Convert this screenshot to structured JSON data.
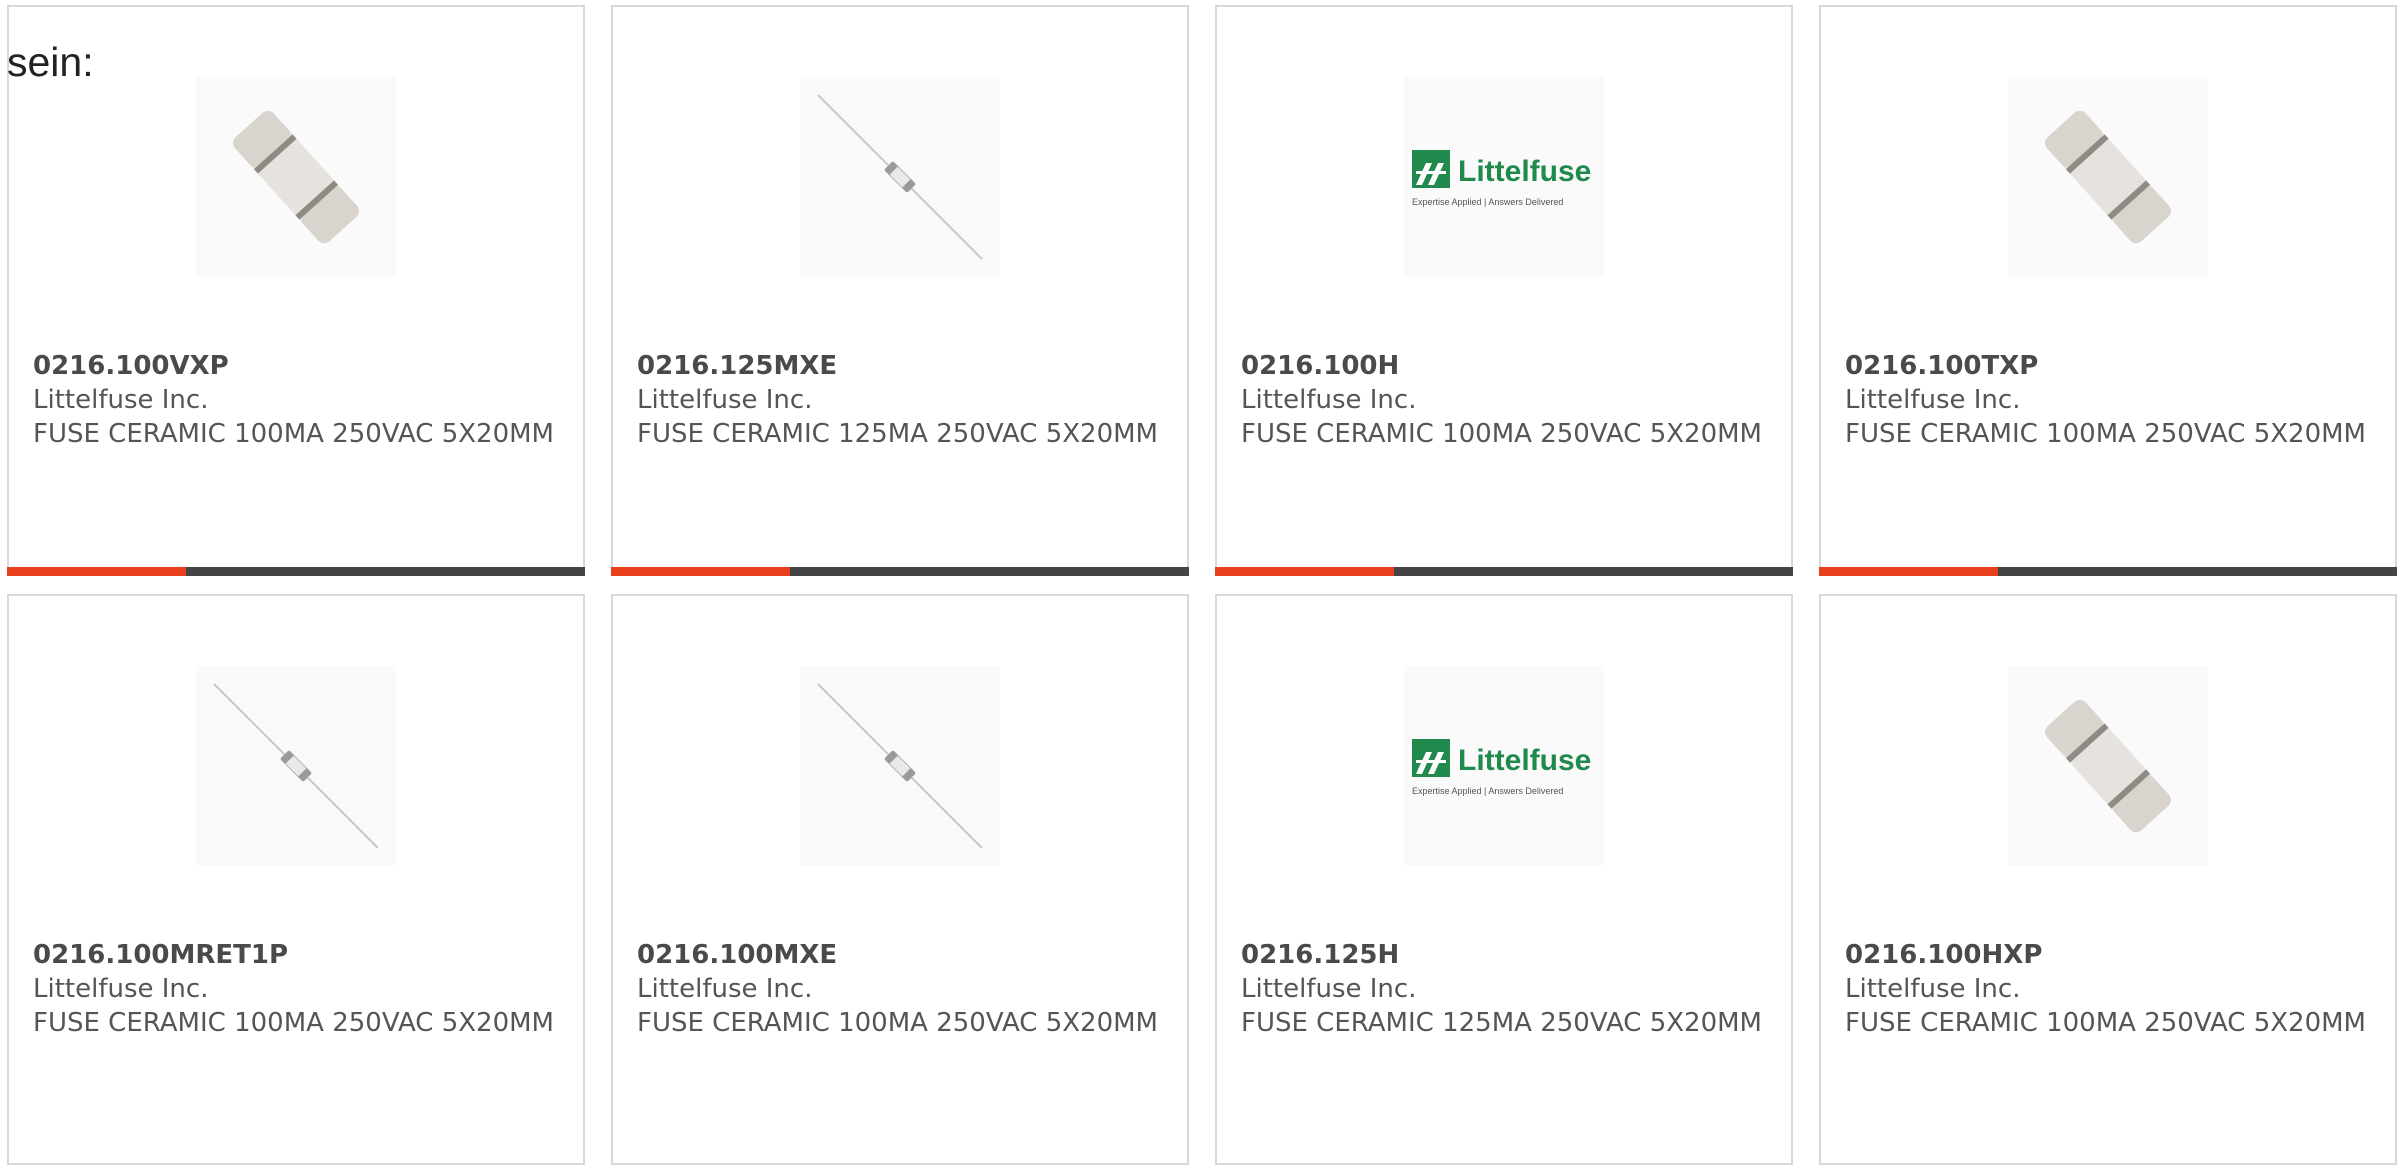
{
  "lead_text": "sein:",
  "colors": {
    "accent": "#e8401c",
    "bar_track": "#444444",
    "card_border": "#d9d9d9",
    "logo_green": "#1f8a4c"
  },
  "logo": {
    "brand": "Littelfuse",
    "tagline": "Expertise Applied | Answers Delivered"
  },
  "cards": [
    {
      "part": "0216.100VXP",
      "manufacturer": "Littelfuse Inc.",
      "description": "FUSE CERAMIC 100MA 250VAC 5X20MM",
      "image": "ceramic-fuse-icon",
      "progress": 0.31
    },
    {
      "part": "0216.125MXE",
      "manufacturer": "Littelfuse Inc.",
      "description": "FUSE CERAMIC 125MA 250VAC 5X20MM",
      "image": "axial-fuse-icon",
      "progress": 0.31
    },
    {
      "part": "0216.100H",
      "manufacturer": "Littelfuse Inc.",
      "description": "FUSE CERAMIC 100MA 250VAC 5X20MM",
      "image": "littelfuse-logo",
      "progress": 0.31
    },
    {
      "part": "0216.100TXP",
      "manufacturer": "Littelfuse Inc.",
      "description": "FUSE CERAMIC 100MA 250VAC 5X20MM",
      "image": "ceramic-fuse-icon",
      "progress": 0.31
    },
    {
      "part": "0216.100MRET1P",
      "manufacturer": "Littelfuse Inc.",
      "description": "FUSE CERAMIC 100MA 250VAC 5X20MM",
      "image": "axial-fuse-icon"
    },
    {
      "part": "0216.100MXE",
      "manufacturer": "Littelfuse Inc.",
      "description": "FUSE CERAMIC 100MA 250VAC 5X20MM",
      "image": "axial-fuse-icon"
    },
    {
      "part": "0216.125H",
      "manufacturer": "Littelfuse Inc.",
      "description": "FUSE CERAMIC 125MA 250VAC 5X20MM",
      "image": "littelfuse-logo"
    },
    {
      "part": "0216.100HXP",
      "manufacturer": "Littelfuse Inc.",
      "description": "FUSE CERAMIC 100MA 250VAC 5X20MM",
      "image": "ceramic-fuse-icon"
    }
  ]
}
